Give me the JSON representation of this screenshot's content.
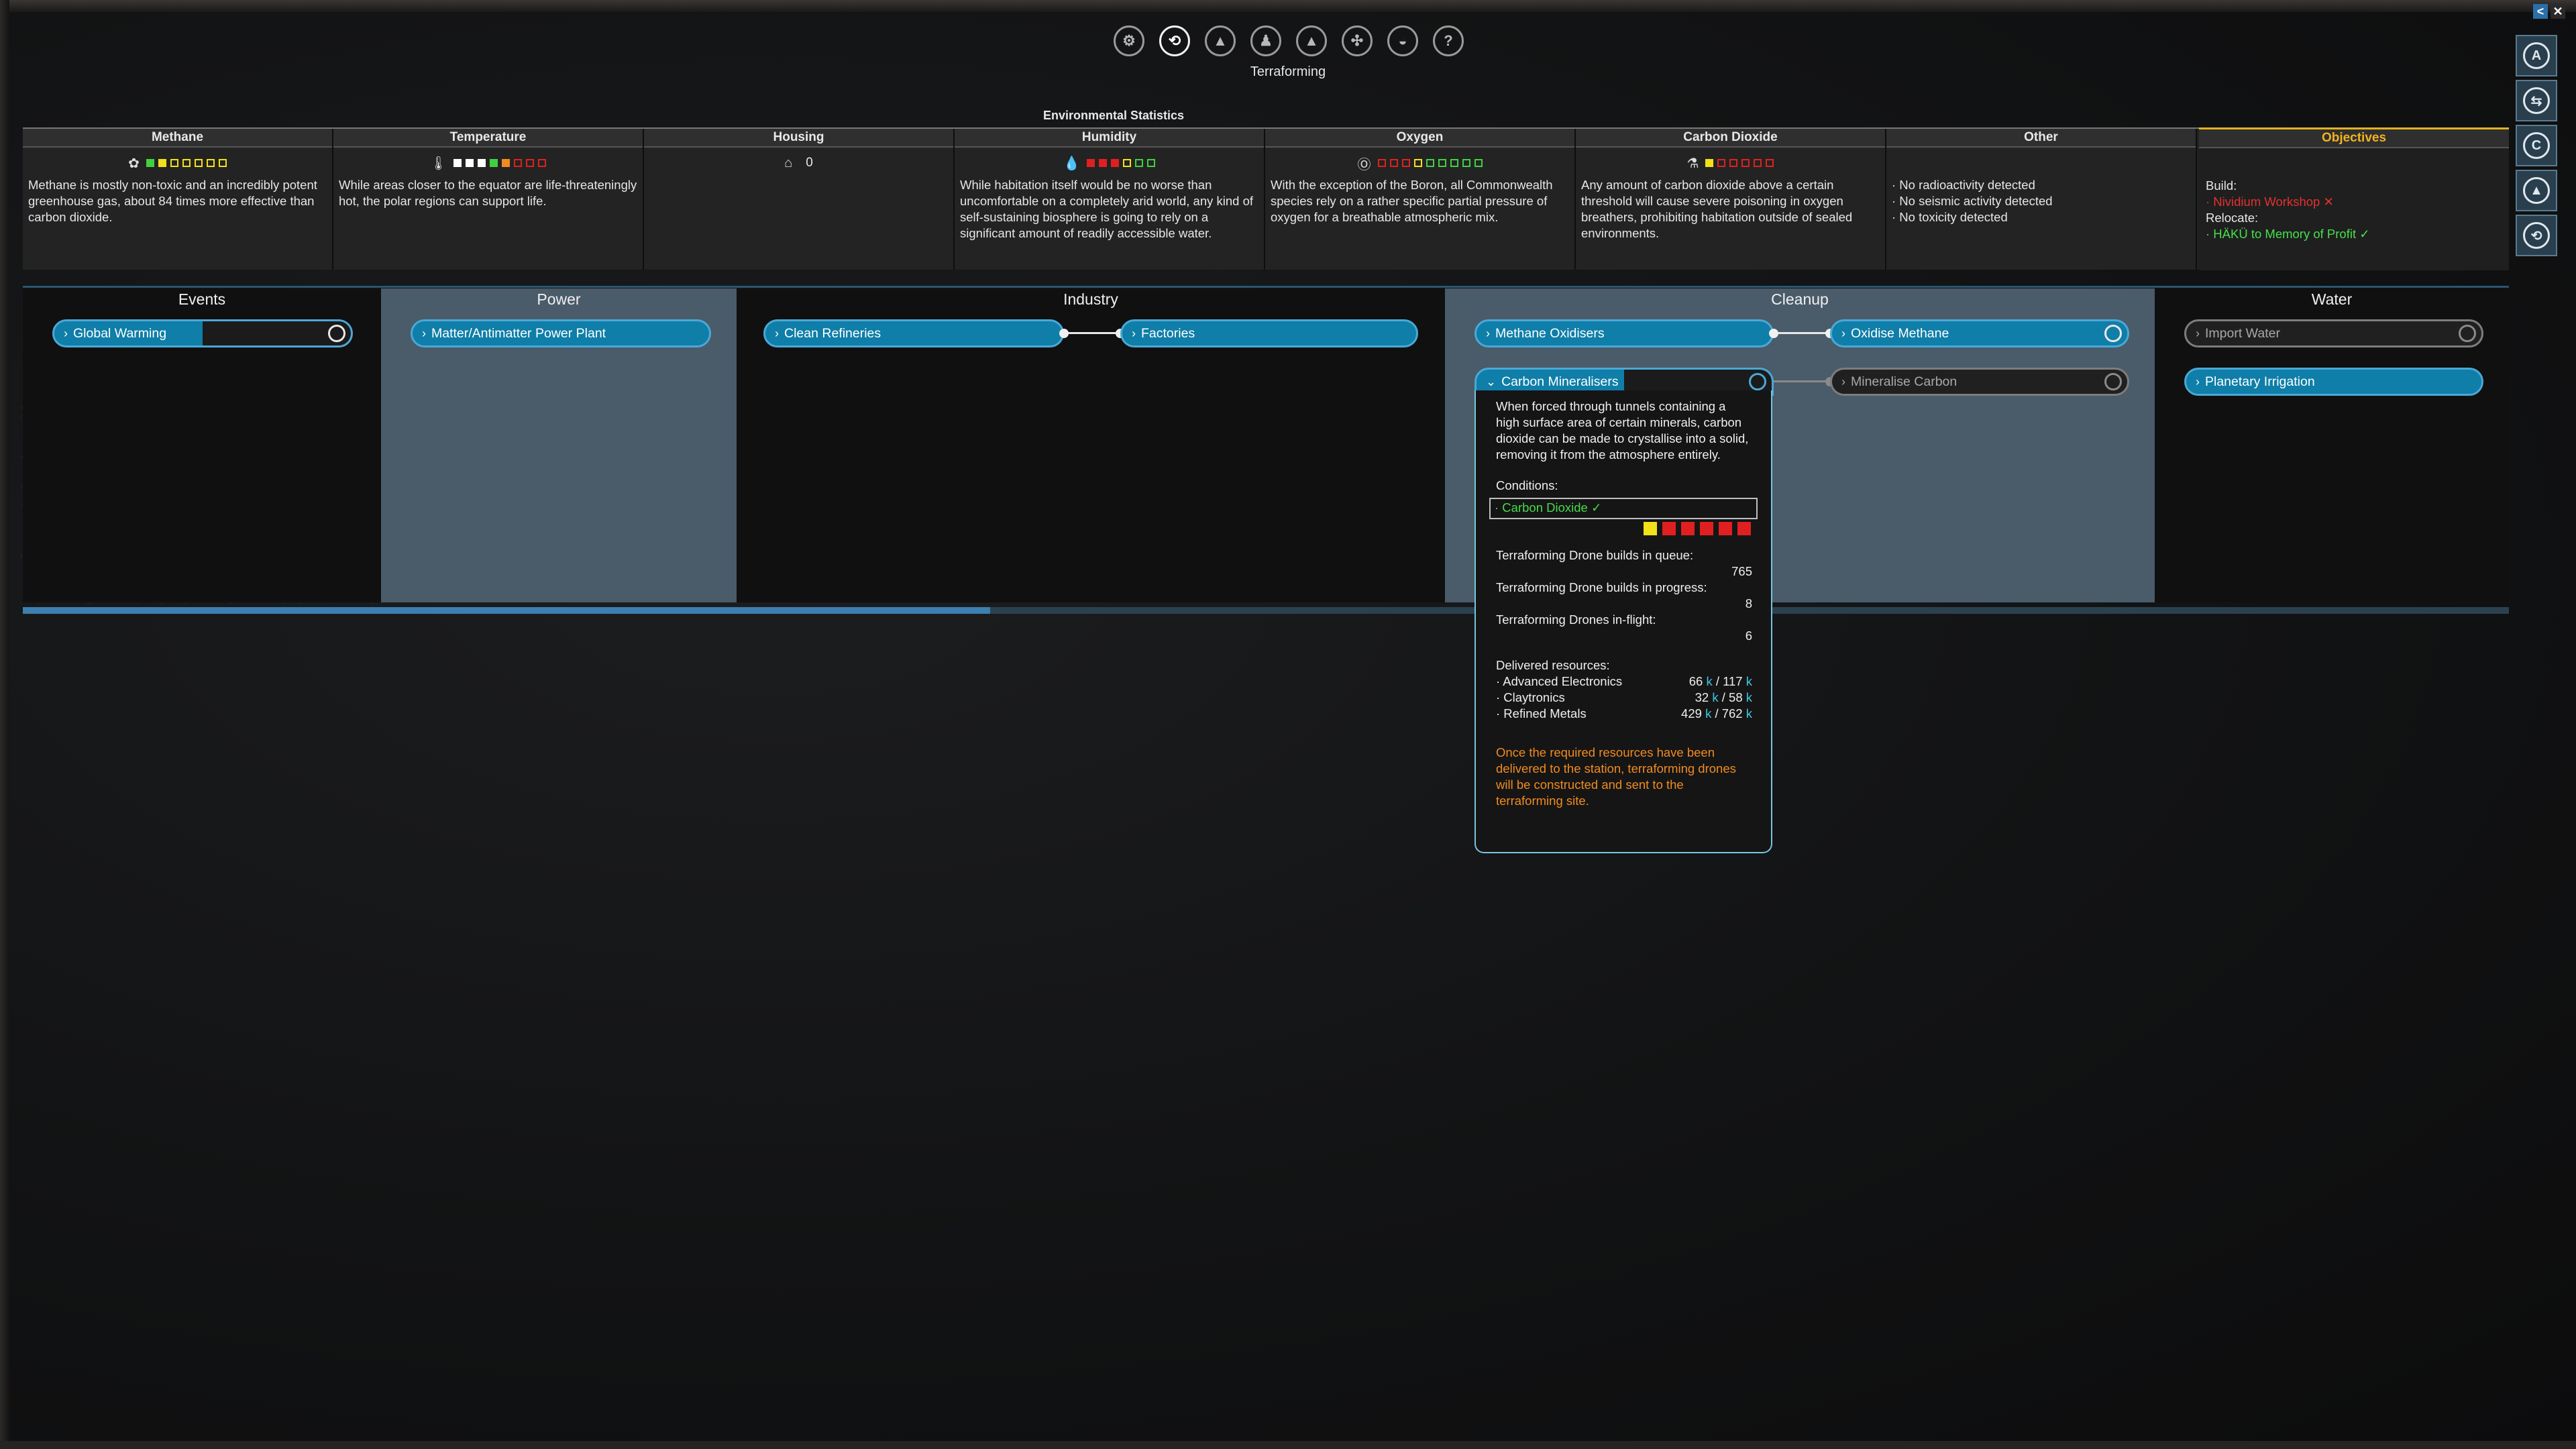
{
  "top_nav": {
    "title": "Terraforming",
    "icons": [
      "gear-icon",
      "terraforming-icon",
      "flask-icon",
      "wrench-icon",
      "rocket-icon",
      "network-icon",
      "dome-icon",
      "help-icon"
    ],
    "icon_glyphs": [
      "⚙",
      "⟲",
      "▲",
      "♟",
      "▲",
      "✣",
      "◒",
      "?"
    ]
  },
  "side_buttons": [
    "A",
    "⇆",
    "C",
    "▲",
    "⟲"
  ],
  "corner_buttons": {
    "back": "<",
    "close": "✕"
  },
  "env": {
    "title": "Environmental Statistics",
    "columns": [
      {
        "name": "Methane",
        "icon": "✿",
        "squares": [
          "#3fd13f",
          "#f2e01a",
          "#f2e01a",
          "#f2e01a",
          "#f2e01a",
          "#f2e01a",
          "#f2e01a"
        ],
        "filled": [
          1,
          1,
          0,
          0,
          0,
          0,
          0
        ],
        "text": "Methane is mostly non-toxic and an incredibly potent greenhouse gas, about 84 times more effective than carbon dioxide."
      },
      {
        "name": "Temperature",
        "icon": "🌡",
        "squares": [
          "#ffffff",
          "#ffffff",
          "#ffffff",
          "#3fd13f",
          "#f08b22",
          "#e02020",
          "#e02020",
          "#e02020"
        ],
        "filled": [
          1,
          1,
          1,
          1,
          1,
          0,
          0,
          0
        ],
        "text": "While areas closer to the equator are life-threateningly hot, the polar regions can support life."
      },
      {
        "name": "Housing",
        "icon": "⌂",
        "squares": [],
        "filled": [],
        "value": "0",
        "text": ""
      },
      {
        "name": "Humidity",
        "icon": "💧",
        "squares": [
          "#e02020",
          "#e02020",
          "#e02020",
          "#f2e01a",
          "#3fd13f",
          "#3fd13f"
        ],
        "filled": [
          1,
          1,
          1,
          0,
          0,
          0
        ],
        "text": "While habitation itself would be no worse than uncomfortable on a completely arid world, any kind of self-sustaining biosphere is going to rely on a significant amount of readily accessible water."
      },
      {
        "name": "Oxygen",
        "icon": "Ⓞ",
        "squares": [
          "#e02020",
          "#e02020",
          "#e02020",
          "#f2e01a",
          "#3fd13f",
          "#3fd13f",
          "#3fd13f",
          "#3fd13f",
          "#3fd13f"
        ],
        "filled": [
          0,
          0,
          0,
          0,
          0,
          0,
          0,
          0,
          0
        ],
        "text": "With the exception of the Boron, all Commonwealth species rely on a rather specific partial pressure of oxygen for a breathable atmospheric mix."
      },
      {
        "name": "Carbon Dioxide",
        "icon": "⚗",
        "squares": [
          "#f2e01a",
          "#e02020",
          "#e02020",
          "#e02020",
          "#e02020",
          "#e02020"
        ],
        "filled": [
          1,
          0,
          0,
          0,
          0,
          0
        ],
        "text": "Any amount of carbon dioxide above a certain threshold will cause severe poisoning in oxygen breathers, prohibiting habitation outside of sealed environments."
      },
      {
        "name": "Other",
        "icon": "",
        "squares": [],
        "filled": [],
        "lines": [
          "· No radioactivity detected",
          "· No seismic activity detected",
          "· No toxicity detected"
        ]
      }
    ],
    "objectives": {
      "title": "Objectives",
      "build_label": "Build:",
      "build_item": "· Nividium Workshop",
      "build_mark": "✕",
      "relocate_label": "Relocate:",
      "relocate_item": "· HÄKÜ to Memory of Profit",
      "relocate_mark": "✓"
    }
  },
  "panels": {
    "events": {
      "title": "Events",
      "items": [
        {
          "label": "Global Warming"
        }
      ]
    },
    "power": {
      "title": "Power",
      "items": [
        {
          "label": "Matter/Antimatter Power Plant"
        }
      ]
    },
    "industry": {
      "title": "Industry",
      "items": [
        {
          "label": "Clean Refineries"
        },
        {
          "label": "Factories"
        }
      ]
    },
    "cleanup": {
      "title": "Cleanup",
      "items": [
        {
          "label": "Methane Oxidisers"
        },
        {
          "label": "Oxidise Methane"
        },
        {
          "label": "Carbon Mineralisers"
        },
        {
          "label": "Mineralise Carbon"
        }
      ]
    },
    "water": {
      "title": "Water",
      "items": [
        {
          "label": "Import Water"
        },
        {
          "label": "Planetary Irrigation"
        }
      ]
    }
  },
  "tooltip": {
    "description": "When forced through tunnels containing a high surface area of certain minerals, carbon dioxide can be made to crystallise into a solid, removing it from the atmosphere entirely.",
    "conditions_label": "Conditions:",
    "condition": "· Carbon Dioxide ✓",
    "condition_squares": [
      "#f2e01a",
      "#e02020",
      "#e02020",
      "#e02020",
      "#e02020",
      "#e02020"
    ],
    "queue_label": "Terraforming Drone builds in queue:",
    "queue_value": "765",
    "progress_label": "Terraforming Drone builds in progress:",
    "progress_value": "8",
    "inflight_label": "Terraforming Drones in-flight:",
    "inflight_value": "6",
    "delivered_label": "Delivered resources:",
    "resources": [
      {
        "name": "· Advanced Electronics",
        "have": "66",
        "need": "117"
      },
      {
        "name": "· Claytronics",
        "have": "32",
        "need": "58"
      },
      {
        "name": "· Refined Metals",
        "have": "429",
        "need": "762"
      }
    ],
    "unit": "k",
    "note": "Once the required resources have been delivered to the station, terraforming drones will be constructed and sent to the terraforming site."
  }
}
